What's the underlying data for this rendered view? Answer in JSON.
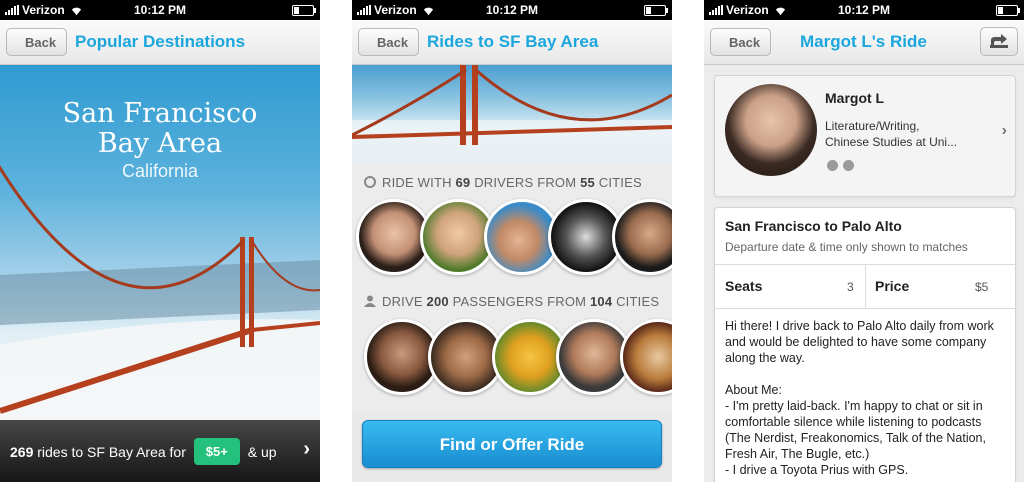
{
  "status": {
    "carrier": "Verizon",
    "time": "10:12 PM"
  },
  "colors": {
    "accent": "#1ba7dd",
    "price_green": "#23c17b",
    "button_blue": "#2aa6e5"
  },
  "screen1": {
    "back_label": "Back",
    "nav_title": "Popular Destinations",
    "hero_title_line1": "San Francisco",
    "hero_title_line2": "Bay Area",
    "hero_subtitle": "California",
    "footer": {
      "count": "269",
      "text": "rides to SF Bay Area for",
      "price": "$5+",
      "suffix": "& up"
    }
  },
  "screen2": {
    "back_label": "Back",
    "nav_title": "Rides to SF Bay Area",
    "drivers_row": {
      "prefix": "RIDE WITH",
      "drivers": "69",
      "middle": "DRIVERS FROM",
      "cities": "55",
      "suffix": "CITIES"
    },
    "passengers_row": {
      "prefix": "DRIVE",
      "passengers": "200",
      "middle": "PASSENGERS FROM",
      "cities": "104",
      "suffix": "CITIES"
    },
    "button_label": "Find or Offer Ride"
  },
  "screen3": {
    "back_label": "Back",
    "nav_title": "Margot L's Ride",
    "profile": {
      "name": "Margot L",
      "job_line1": "Literature/Writing,",
      "job_line2": "Chinese Studies at Uni..."
    },
    "route": {
      "title": "San Francisco to Palo Alto",
      "subtitle": "Departure date & time only shown to matches",
      "seats_label": "Seats",
      "seats_value": "3",
      "price_label": "Price",
      "price_value": "$5",
      "description": "Hi there! I drive back to Palo Alto daily from work and would be delighted to have some company along the way.\n\nAbout Me:\n- I'm pretty laid-back. I'm happy to chat or sit in comfortable silence while listening to podcasts (The Nerdist, Freakonomics, Talk of the Nation, Fresh Air, The Bugle, etc.)\n- I drive a Toyota Prius with GPS."
    }
  }
}
